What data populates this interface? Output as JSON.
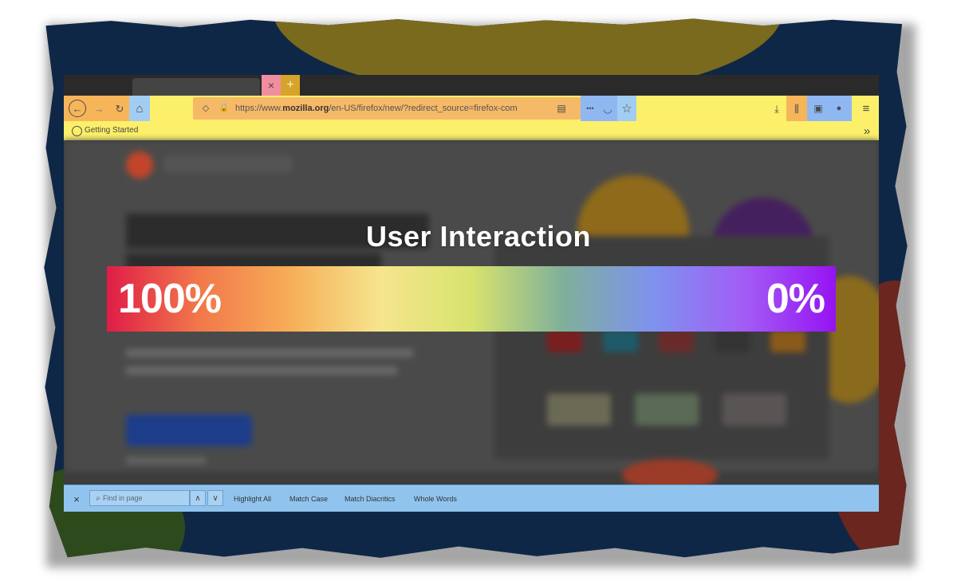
{
  "overlay": {
    "title": "User Interaction",
    "scale_left": "100%",
    "scale_right": "0%",
    "gradient_colors": [
      "#e01d47",
      "#f1774a",
      "#f7ad57",
      "#f6e58e",
      "#d8e36d",
      "#7fb09a",
      "#7e92ef",
      "#a25cf5",
      "#9613f2"
    ]
  },
  "browser": {
    "tab_close_glyph": "×",
    "new_tab_glyph": "+",
    "nav": {
      "back_glyph": "←",
      "forward_glyph": "→",
      "reload_glyph": "↻",
      "home_glyph": "⌂"
    },
    "url": {
      "prefix": "https://www.",
      "domain": "mozilla.org",
      "path": "/en-US/firefox/new/?redirect_source=firefox-com",
      "shield_glyph": "◇",
      "lock_glyph": "🔒",
      "reader_glyph": "▤",
      "more_glyph": "•••",
      "pocket_glyph": "◡",
      "star_glyph": "☆"
    },
    "toolbar_right": {
      "download_glyph": "⤓",
      "library_glyph": "⫼",
      "sidebar_glyph": "▣",
      "account_glyph": "●",
      "menu_glyph": "≡"
    },
    "bookmarks": {
      "item_label": "Getting Started",
      "overflow_glyph": "»"
    },
    "findbar": {
      "close_glyph": "×",
      "placeholder": "Find in page",
      "prev_glyph": "∧",
      "next_glyph": "∨",
      "options": [
        "Highlight All",
        "Match Case",
        "Match Diacritics",
        "Whole Words"
      ]
    }
  },
  "highlight_colors": {
    "toolbar": "#fcf06a",
    "nav_buttons": "#f7b55a",
    "home": "#a2cdf2",
    "url_bar": "#f6b968",
    "page_actions": "#8fb8f2",
    "tab_close": "#f08da0",
    "new_tab": "#d6a42a",
    "findbar": "#90c4ee"
  }
}
